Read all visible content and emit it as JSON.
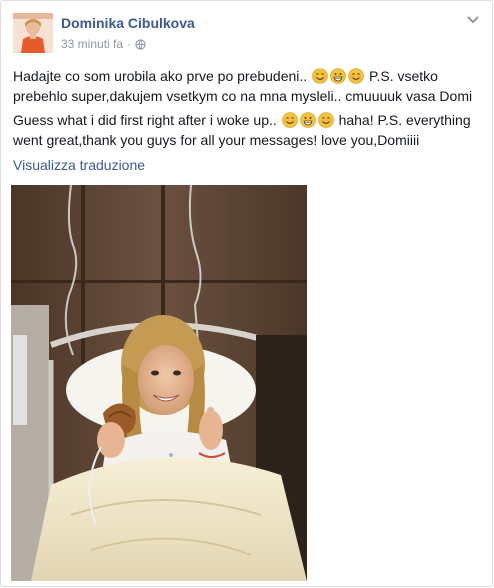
{
  "post": {
    "author": "Dominika Cibulkova",
    "timestamp": "33 minuti fa",
    "separator": "·",
    "privacy_icon": "globe-icon",
    "menu_icon": "chevron-down-icon",
    "text_sk_before": "Hadajte co som urobila ako prve po prebudeni..",
    "text_sk_after": "P.S. vsetko prebehlo super,dakujem vsetkym co na mna mysleli.. cmuuuuk vasa Domi",
    "text_en_before": "Guess what i did first right after i woke up..",
    "text_en_after": "haha! P.S. everything went great,thank you guys for all your messages! love you,Domiiii",
    "translate_link": "Visualizza traduzione",
    "emoji_sequence": [
      "smile-emoji",
      "grin-emoji",
      "smile-emoji"
    ]
  },
  "colors": {
    "link": "#3b5998",
    "meta": "#9197a3",
    "text": "#141823",
    "emoji": "#f5c33b"
  }
}
